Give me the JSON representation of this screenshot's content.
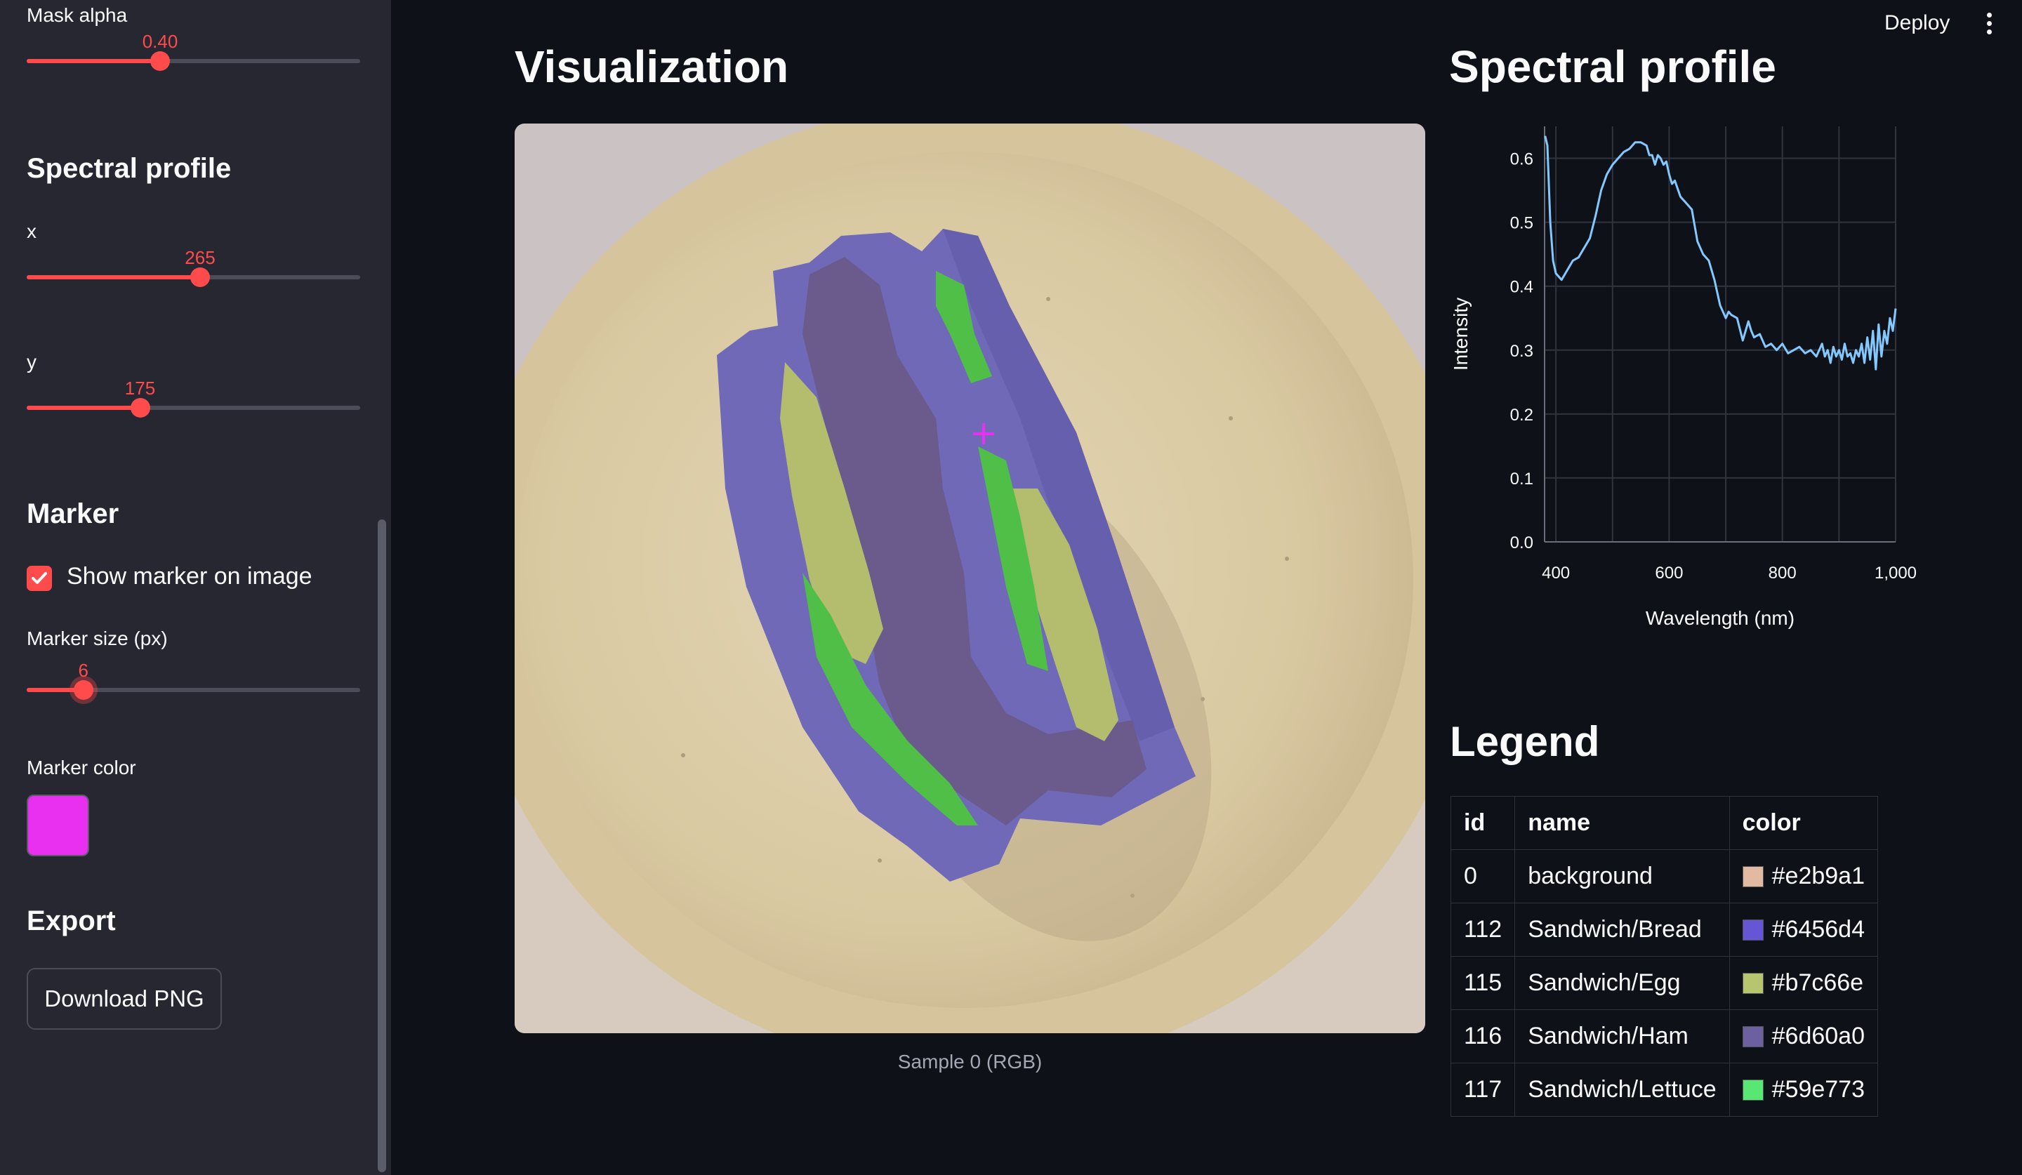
{
  "sidebar": {
    "mask_alpha": {
      "label": "Mask alpha",
      "value": "0.40",
      "fraction": 0.4
    },
    "spectral_section": "Spectral profile",
    "x_slider": {
      "label": "x",
      "value": "265",
      "fraction": 0.52
    },
    "y_slider": {
      "label": "y",
      "value": "175",
      "fraction": 0.34
    },
    "marker_section": "Marker",
    "show_marker": {
      "label": "Show marker on image",
      "checked": true
    },
    "marker_size": {
      "label": "Marker size (px)",
      "value": "6",
      "fraction": 0.17
    },
    "marker_color": {
      "label": "Marker color",
      "value": "#e92ff0"
    },
    "export_section": "Export",
    "download_button": "Download PNG"
  },
  "header": {
    "deploy": "Deploy"
  },
  "main": {
    "viz_title": "Visualization",
    "viz_caption": "Sample 0 (RGB)",
    "spectral_title": "Spectral profile",
    "legend_title": "Legend"
  },
  "chart_data": {
    "type": "line",
    "title": "Spectral profile",
    "xlabel": "Wavelength (nm)",
    "ylabel": "Intensity",
    "xlim": [
      380,
      1000
    ],
    "ylim": [
      0,
      0.65
    ],
    "xticks": [
      "400",
      "600",
      "800",
      "1,000"
    ],
    "yticks": [
      "0.0",
      "0.1",
      "0.2",
      "0.3",
      "0.4",
      "0.5",
      "0.6"
    ],
    "color": "#83c9ff",
    "grid": true,
    "series": [
      {
        "x": [
          381,
          385,
          390,
          395,
          400,
          410,
          420,
          430,
          440,
          450,
          460,
          470,
          480,
          490,
          500,
          510,
          520,
          530,
          540,
          550,
          560,
          565,
          570,
          575,
          580,
          585,
          590,
          595,
          600,
          605,
          610,
          620,
          630,
          640,
          650,
          660,
          670,
          680,
          690,
          700,
          705,
          710,
          720,
          730,
          740,
          745,
          750,
          760,
          770,
          780,
          790,
          800,
          810,
          820,
          830,
          840,
          850,
          860,
          870,
          875,
          880,
          885,
          890,
          895,
          900,
          905,
          910,
          915,
          920,
          925,
          930,
          935,
          940,
          945,
          950,
          955,
          960,
          965,
          970,
          975,
          980,
          985,
          990,
          995,
          1000
        ],
        "y": [
          0.635,
          0.62,
          0.5,
          0.44,
          0.42,
          0.41,
          0.425,
          0.44,
          0.445,
          0.46,
          0.475,
          0.51,
          0.55,
          0.575,
          0.59,
          0.6,
          0.61,
          0.615,
          0.625,
          0.625,
          0.62,
          0.605,
          0.605,
          0.59,
          0.605,
          0.6,
          0.59,
          0.595,
          0.575,
          0.56,
          0.565,
          0.54,
          0.53,
          0.52,
          0.47,
          0.45,
          0.44,
          0.41,
          0.37,
          0.35,
          0.36,
          0.355,
          0.35,
          0.315,
          0.345,
          0.33,
          0.32,
          0.325,
          0.305,
          0.31,
          0.3,
          0.31,
          0.295,
          0.3,
          0.305,
          0.295,
          0.3,
          0.29,
          0.31,
          0.29,
          0.3,
          0.28,
          0.305,
          0.29,
          0.3,
          0.285,
          0.31,
          0.29,
          0.295,
          0.28,
          0.3,
          0.29,
          0.31,
          0.28,
          0.32,
          0.285,
          0.33,
          0.27,
          0.34,
          0.29,
          0.33,
          0.31,
          0.35,
          0.33,
          0.365
        ]
      }
    ]
  },
  "legend_table": {
    "headers": [
      "id",
      "name",
      "color"
    ],
    "rows": [
      {
        "id": "0",
        "name": "background",
        "color": "#e2b9a1"
      },
      {
        "id": "112",
        "name": "Sandwich/Bread",
        "color": "#6456d4"
      },
      {
        "id": "115",
        "name": "Sandwich/Egg",
        "color": "#b7c66e"
      },
      {
        "id": "116",
        "name": "Sandwich/Ham",
        "color": "#6d60a0"
      },
      {
        "id": "117",
        "name": "Sandwich/Lettuce",
        "color": "#59e773"
      }
    ]
  }
}
